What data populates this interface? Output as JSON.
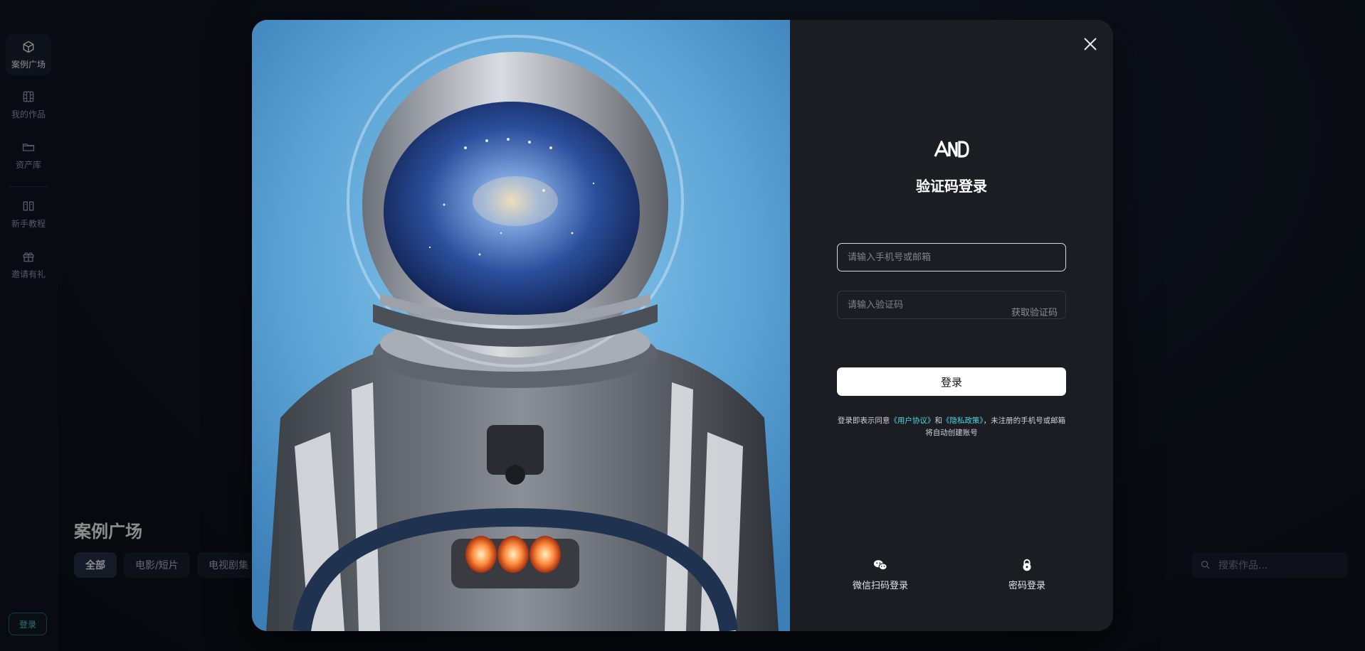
{
  "sidebar": {
    "items": [
      {
        "label": "案例广场",
        "icon": "cube-icon",
        "active": true
      },
      {
        "label": "我的作品",
        "icon": "film-icon",
        "active": false
      },
      {
        "label": "资产库",
        "icon": "folder-icon",
        "active": false
      },
      {
        "label": "新手教程",
        "icon": "book-icon",
        "active": false
      },
      {
        "label": "邀请有礼",
        "icon": "gift-icon",
        "active": false
      }
    ],
    "login_label": "登录"
  },
  "gallery": {
    "title": "案例广场",
    "filters": [
      "全部",
      "电影/短片",
      "电视剧集"
    ],
    "active_filter": "全部",
    "search_placeholder": "搜索作品..."
  },
  "modal": {
    "logo": "AND",
    "title": "验证码登录",
    "account_placeholder": "请输入手机号或邮箱",
    "code_placeholder": "请输入验证码",
    "get_code_label": "获取验证码",
    "submit_label": "登录",
    "agreement": {
      "prefix": "登录即表示同意",
      "user_agreement": "《用户协议》",
      "and": "和",
      "privacy_policy": "《隐私政策》",
      "suffix": "，未注册的手机号或邮箱将自动创建账号"
    },
    "alt_logins": [
      {
        "label": "微信扫码登录",
        "icon": "wechat-icon"
      },
      {
        "label": "密码登录",
        "icon": "lock-icon"
      }
    ]
  },
  "colors": {
    "accent": "#4fd6e3",
    "panel_bg": "#1c1d22",
    "page_bg": "#0c1019"
  }
}
